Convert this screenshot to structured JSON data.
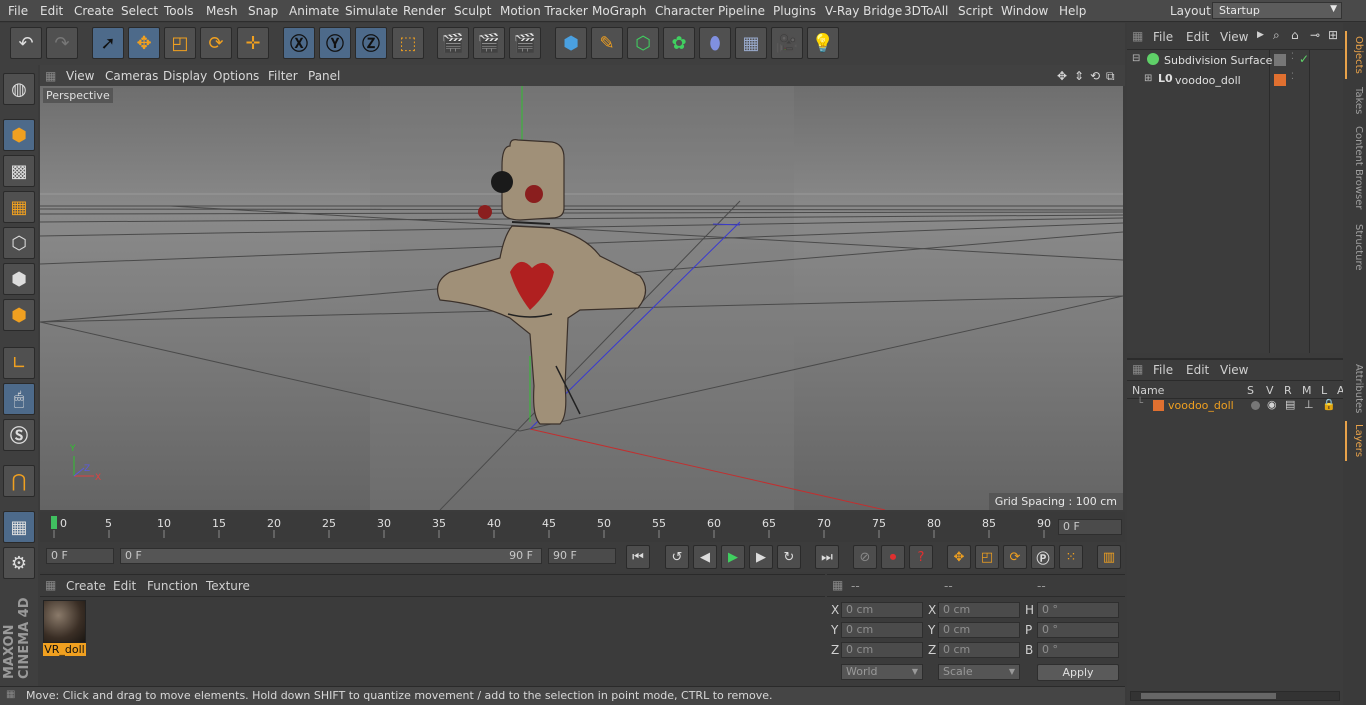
{
  "menu": [
    "File",
    "Edit",
    "Create",
    "Select",
    "Tools",
    "Mesh",
    "Snap",
    "Animate",
    "Simulate",
    "Render",
    "Sculpt",
    "Motion Tracker",
    "MoGraph",
    "Character",
    "Pipeline",
    "Plugins",
    "V-Ray Bridge",
    "3DToAll",
    "Script",
    "Window",
    "Help"
  ],
  "layout": {
    "label": "Layout:",
    "value": "Startup"
  },
  "viewport": {
    "menu": [
      "View",
      "Cameras",
      "Display",
      "Options",
      "Filter",
      "Panel"
    ],
    "label": "Perspective",
    "grid_spacing": "Grid Spacing : 100 cm",
    "axis_y": "Y",
    "axis_z": "Z",
    "axis_x": "X"
  },
  "timeline": {
    "ticks": [
      "0",
      "5",
      "10",
      "15",
      "20",
      "25",
      "30",
      "35",
      "40",
      "45",
      "50",
      "55",
      "60",
      "65",
      "70",
      "75",
      "80",
      "85",
      "90"
    ],
    "current_frame": "0 F",
    "start_field": "0 F",
    "range_start": "0 F",
    "range_end": "90 F",
    "end_field": "90 F"
  },
  "materials": {
    "menu": [
      "Create",
      "Edit",
      "Function",
      "Texture"
    ],
    "items": [
      {
        "name": "VR_doll"
      }
    ]
  },
  "coords": {
    "headers": [
      "--",
      "--",
      "--"
    ],
    "rows": [
      {
        "a": "X",
        "av": "0 cm",
        "b": "X",
        "bv": "0 cm",
        "c": "H",
        "cv": "0 °"
      },
      {
        "a": "Y",
        "av": "0 cm",
        "b": "Y",
        "bv": "0 cm",
        "c": "P",
        "cv": "0 °"
      },
      {
        "a": "Z",
        "av": "0 cm",
        "b": "Z",
        "bv": "0 cm",
        "c": "B",
        "cv": "0 °"
      }
    ],
    "mode": "World",
    "transform": "Scale",
    "apply": "Apply"
  },
  "objects": {
    "menu": [
      "File",
      "Edit",
      "View"
    ],
    "items": [
      {
        "name": "Subdivision Surface",
        "color": "#5fd068"
      },
      {
        "name": "voodoo_doll",
        "color": "#e07030"
      }
    ]
  },
  "layers": {
    "menu": [
      "File",
      "Edit",
      "View"
    ],
    "columns": [
      "Name",
      "S",
      "V",
      "R",
      "M",
      "L",
      "A"
    ],
    "items": [
      {
        "name": "voodoo_doll",
        "color": "#e07030"
      }
    ]
  },
  "side_tabs": [
    "Objects",
    "Takes",
    "Content Browser",
    "Structure",
    "Attributes",
    "Layers"
  ],
  "brand": "MAXON CINEMA 4D",
  "status": "Move: Click and drag to move elements. Hold down SHIFT to quantize movement / add to the selection in point mode, CTRL to remove.",
  "colors": {
    "accent": "#e8a24a",
    "active_tool": "#4d6a8a",
    "grid_red": "#c03030",
    "grid_blue": "#3a3ad0",
    "grid_green": "#30c030"
  }
}
